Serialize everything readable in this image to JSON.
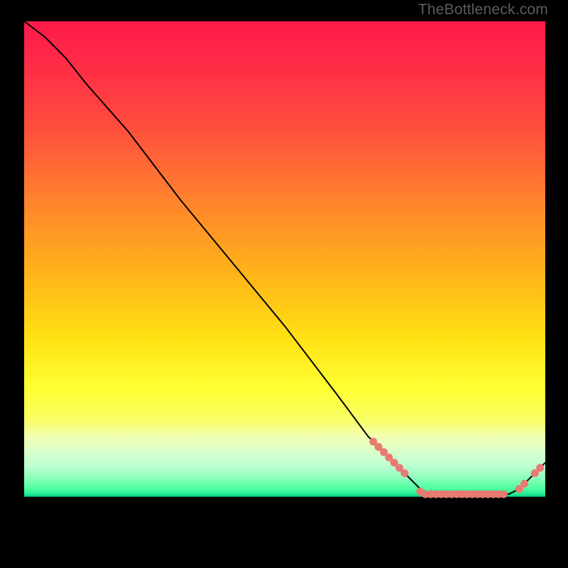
{
  "branding": {
    "site_label": "TheBottleneck.com"
  },
  "colors": {
    "dot": "#e97a72",
    "line": "#000000",
    "gradient_top": "#ff1a4b",
    "gradient_bottom": "#00d084",
    "background": "#000000"
  },
  "chart_data": {
    "type": "line",
    "title": "",
    "xlabel": "",
    "ylabel": "",
    "xlim": [
      0,
      100
    ],
    "ylim": [
      0,
      100
    ],
    "grid": false,
    "legend": false,
    "x": [
      0,
      4,
      8,
      12,
      20,
      30,
      40,
      50,
      60,
      66,
      68,
      69,
      70,
      71,
      72,
      73,
      74,
      75,
      76,
      77,
      78,
      79,
      80,
      81,
      82,
      83,
      84,
      85,
      86,
      87,
      88,
      89,
      90,
      91,
      92,
      93,
      94,
      95,
      96,
      98,
      100
    ],
    "y": [
      100,
      97,
      93,
      88,
      79,
      66,
      54,
      42,
      29,
      21,
      19,
      18,
      17,
      16,
      15,
      14,
      13,
      12,
      11,
      10.5,
      10,
      10,
      10,
      10,
      10,
      10,
      10,
      10,
      10,
      10,
      10,
      10,
      10,
      10,
      10,
      10,
      10.5,
      11,
      12,
      14,
      16
    ],
    "markers": {
      "x": [
        67,
        68,
        69,
        70,
        71,
        72,
        73,
        76,
        77,
        78,
        79,
        80,
        81,
        82,
        83,
        84,
        85,
        86,
        87,
        88,
        89,
        90,
        91,
        92,
        95,
        96,
        98,
        99
      ],
      "y": [
        20,
        19,
        18,
        17,
        16,
        15,
        14,
        10.5,
        10,
        10,
        10,
        10,
        10,
        10,
        10,
        10,
        10,
        10,
        10,
        10,
        10,
        10,
        10,
        10,
        11,
        12,
        14,
        15
      ]
    }
  }
}
